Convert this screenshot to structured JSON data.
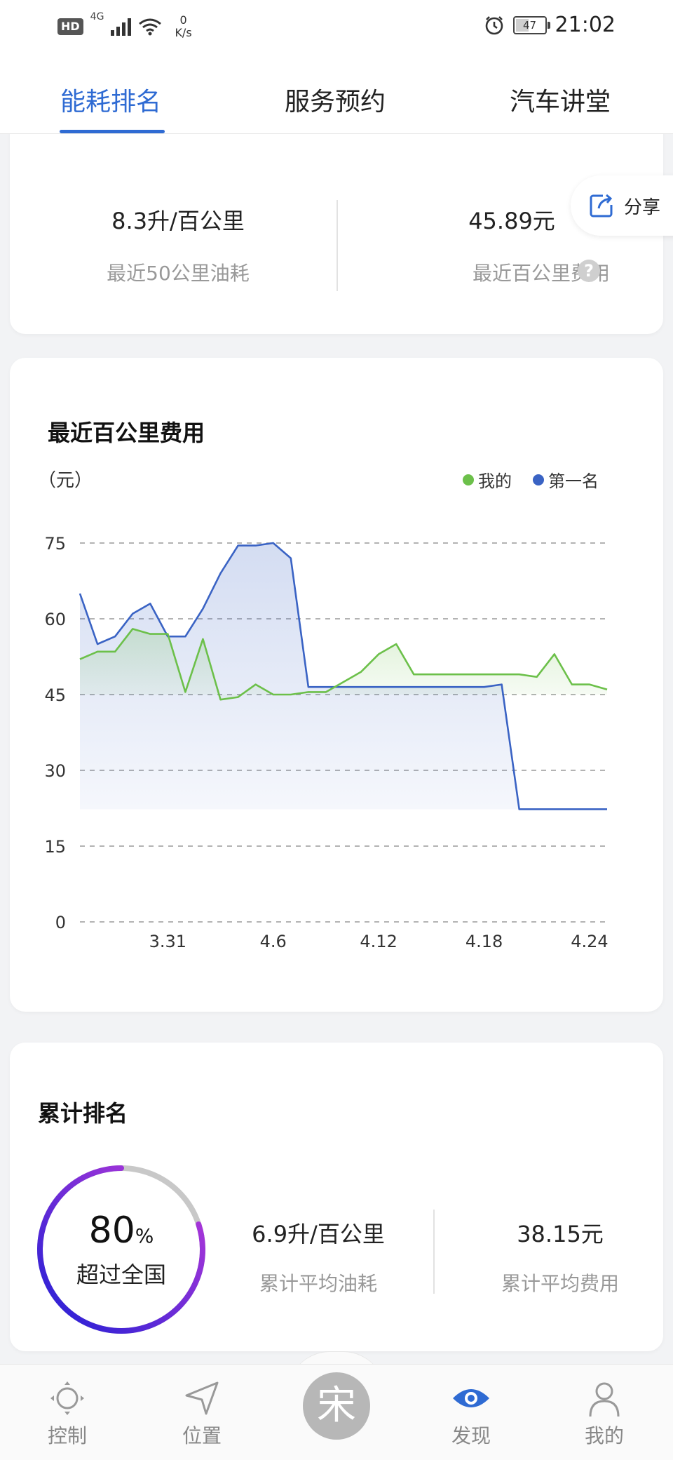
{
  "status_bar": {
    "hd": "HD",
    "network": "4G",
    "speed_value": "0",
    "speed_unit": "K/s",
    "battery": "47",
    "battery_level": 0.47,
    "time": "21:02"
  },
  "tabs": [
    {
      "label": "能耗排名",
      "active": true
    },
    {
      "label": "服务预约",
      "active": false
    },
    {
      "label": "汽车讲堂",
      "active": false
    }
  ],
  "summary": {
    "fuel_value": "8.3升/百公里",
    "fuel_label": "最近50公里油耗",
    "cost_value": "45.89元",
    "cost_label": "最近百公里费用",
    "help_glyph": "?"
  },
  "share": {
    "label": "分享"
  },
  "chart_card": {
    "title": "最近百公里费用",
    "unit": "（元）"
  },
  "chart_data": {
    "type": "line",
    "title": "最近百公里费用",
    "ylabel": "（元）",
    "ylim": [
      0,
      75
    ],
    "yticks": [
      0,
      15,
      30,
      45,
      60,
      75
    ],
    "x_tick_labels": [
      {
        "index": 5,
        "label": "3.31"
      },
      {
        "index": 11,
        "label": "4.6"
      },
      {
        "index": 17,
        "label": "4.12"
      },
      {
        "index": 23,
        "label": "4.18"
      },
      {
        "index": 29,
        "label": "4.24"
      }
    ],
    "grid": "horizontal-dashed",
    "legend": "top-right",
    "series": [
      {
        "name": "我的",
        "color": "#6cc04a",
        "values": [
          52,
          53.5,
          53.5,
          58,
          57,
          57,
          45.5,
          56,
          44,
          44.5,
          47,
          45,
          45,
          45.5,
          45.5,
          47.5,
          49.5,
          53,
          55,
          49,
          49,
          49,
          49,
          49,
          49,
          49,
          48.5,
          53,
          47,
          47,
          46
        ]
      },
      {
        "name": "第一名",
        "color": "#3a63c4",
        "values": [
          65,
          55,
          56.5,
          61,
          63,
          56.5,
          56.5,
          62,
          69,
          74.5,
          74.5,
          75,
          72,
          46.5,
          46.5,
          46.5,
          46.5,
          46.5,
          46.5,
          46.5,
          46.5,
          46.5,
          46.5,
          46.5,
          47,
          22.3,
          22.3,
          22.3,
          22.3,
          22.3,
          22.3
        ]
      }
    ]
  },
  "rank_card": {
    "title": "累计排名",
    "percent": "80",
    "percent_sign": "%",
    "percent_value": 0.8,
    "ring_label": "超过全国",
    "avg_fuel_value": "6.9升/百公里",
    "avg_fuel_label": "累计平均油耗",
    "avg_cost_value": "38.15元",
    "avg_cost_label": "累计平均费用"
  },
  "bottom_nav": [
    {
      "label": "控制",
      "icon": "control-icon",
      "active": false
    },
    {
      "label": "位置",
      "icon": "location-arrow-icon",
      "active": false
    },
    {
      "label": "宋",
      "icon": "song-logo-icon",
      "active": false
    },
    {
      "label": "发现",
      "icon": "eye-icon",
      "active": true
    },
    {
      "label": "我的",
      "icon": "user-icon",
      "active": false
    }
  ],
  "colors": {
    "accent": "#2f6bd3",
    "my_series": "#6cc04a",
    "top_series": "#3a63c4",
    "ring_start": "#1f1fd6",
    "ring_end": "#c23ad8",
    "ring_track": "#c8c8c8"
  }
}
